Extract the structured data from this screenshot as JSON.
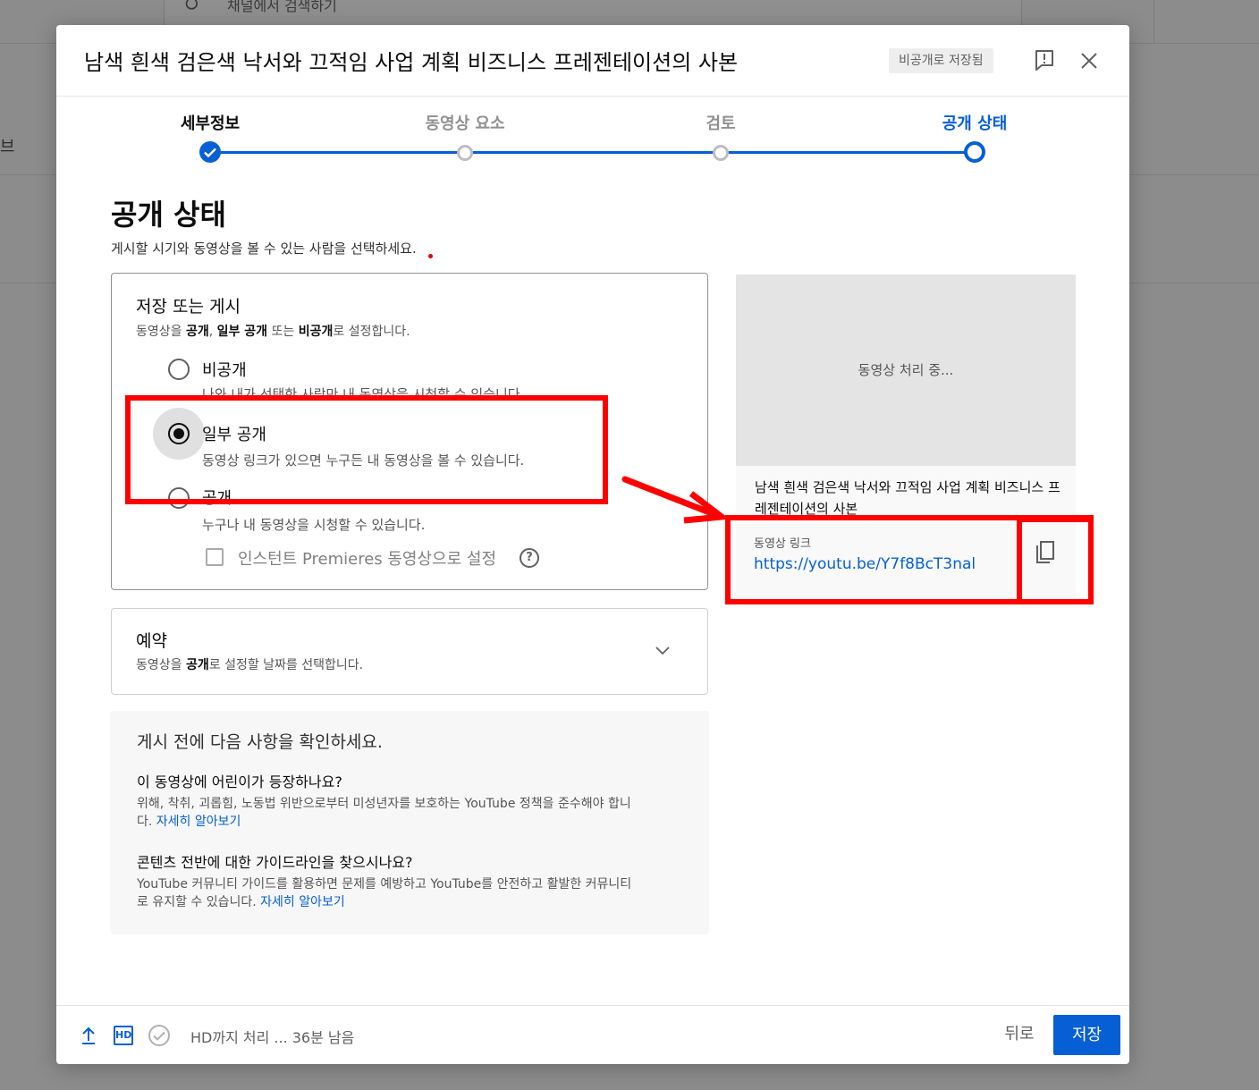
{
  "background": {
    "search_placeholder": "채널에서 검색하기",
    "left_text": "브"
  },
  "dialog": {
    "title": "남색 흰색 검은색 낙서와 끄적임 사업 계획 비즈니스 프레젠테이션의 사본",
    "saved_badge": "비공개로 저장됨",
    "icons": {
      "feedback": "feedback-icon",
      "close": "close-icon"
    }
  },
  "stepper": {
    "steps": [
      {
        "label": "세부정보",
        "state": "done"
      },
      {
        "label": "동영상 요소",
        "state": "pending"
      },
      {
        "label": "검토",
        "state": "pending"
      },
      {
        "label": "공개 상태",
        "state": "current"
      }
    ]
  },
  "visibility": {
    "title": "공개 상태",
    "subtitle": "게시할 시기와 동영상을 볼 수 있는 사람을 선택하세요.",
    "save_card": {
      "title": "저장 또는 게시",
      "desc_prefix": "동영상을 ",
      "desc_public": "공개",
      "desc_sep1": ", ",
      "desc_unlisted": "일부 공개",
      "desc_mid": " 또는 ",
      "desc_private": "비공개",
      "desc_suffix": "로 설정합니다.",
      "options": [
        {
          "label": "비공개",
          "desc": "나와 내가 선택한 사람만 내 동영상을 시청할 수 있습니다",
          "selected": false
        },
        {
          "label": "일부 공개",
          "desc": "동영상 링크가 있으면 누구든 내 동영상을 볼 수 있습니다.",
          "selected": true
        },
        {
          "label": "공개",
          "desc": "누구나 내 동영상을 시청할 수 있습니다.",
          "selected": false
        }
      ],
      "premiere_label": "인스턴트 Premieres 동영상으로 설정",
      "help": "?"
    },
    "schedule_card": {
      "title": "예약",
      "desc_prefix": "동영상을 ",
      "desc_bold": "공개",
      "desc_suffix": "로 설정할 날짜를 선택합니다."
    },
    "checklist": {
      "title": "게시 전에 다음 사항을 확인하세요.",
      "q1": "이 동영상에 어린이가 등장하나요?",
      "a1": "위해, 착취, 괴롭힘, 노동법 위반으로부터 미성년자를 보호하는 YouTube 정책을 준수해야 합니다. ",
      "a1_link": "자세히 알아보기",
      "q2": "콘텐츠 전반에 대한 가이드라인을 찾으시나요?",
      "a2": "YouTube 커뮤니티 가이드를 활용하면 문제를 예방하고 YouTube를 안전하고 활발한 커뮤니티로 유지할 수 있습니다. ",
      "a2_link": "자세히 알아보기"
    }
  },
  "preview": {
    "processing": "동영상 처리 중...",
    "title": "남색 흰색 검은색 낙서와 끄적임 사업 계획 비즈니스 프레젠테이션의 사본",
    "link_label": "동영상 링크",
    "link_url": "https://youtu.be/Y7f8BcT3nal"
  },
  "footer": {
    "status": "HD까지 처리 ... 36분 남음",
    "hd": "HD",
    "back": "뒤로",
    "save": "저장"
  },
  "colors": {
    "accent": "#065fd4",
    "annotation": "#ff0000"
  }
}
